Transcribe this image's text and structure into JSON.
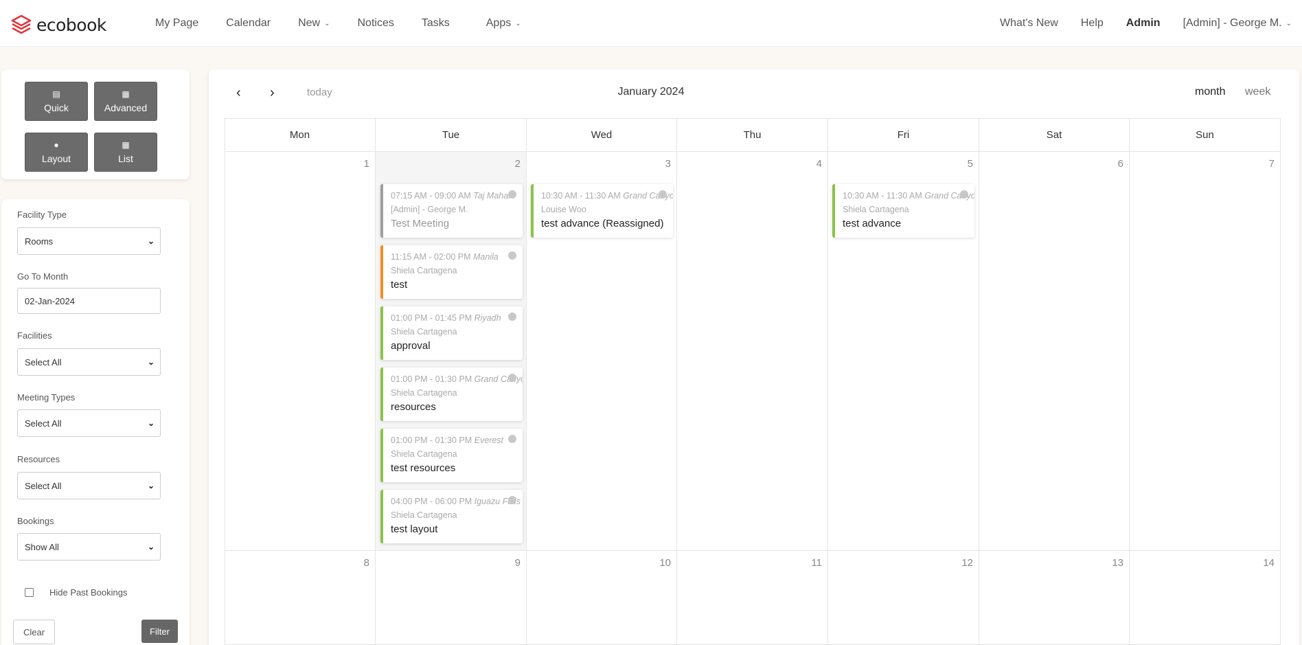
{
  "app": {
    "name": "ecobook"
  },
  "nav": {
    "items": [
      {
        "label": "My Page",
        "dropdown": false
      },
      {
        "label": "Calendar",
        "dropdown": false
      },
      {
        "label": "New",
        "dropdown": true
      },
      {
        "label": "Notices",
        "dropdown": false
      },
      {
        "label": "Tasks",
        "dropdown": false
      },
      {
        "label": "Apps",
        "dropdown": true
      }
    ],
    "right": {
      "whats_new": "What's New",
      "help": "Help",
      "admin": "Admin",
      "user": "[Admin] - George M."
    }
  },
  "view_buttons": [
    {
      "label": "Quick",
      "icon": "list-icon"
    },
    {
      "label": "Advanced",
      "icon": "calendar-icon"
    },
    {
      "label": "Layout",
      "icon": "map-pin-icon"
    },
    {
      "label": "List",
      "icon": "table-icon"
    }
  ],
  "filters": {
    "facility_type": {
      "label": "Facility Type",
      "value": "Rooms"
    },
    "go_to_month": {
      "label": "Go To Month",
      "value": "02-Jan-2024"
    },
    "facilities": {
      "label": "Facilities",
      "value": "Select All"
    },
    "meeting_types": {
      "label": "Meeting Types",
      "value": "Select All"
    },
    "resources": {
      "label": "Resources",
      "value": "Select All"
    },
    "bookings": {
      "label": "Bookings",
      "value": "Show All"
    },
    "hide_past": {
      "label": "Hide Past Bookings",
      "checked": false
    },
    "clear_label": "Clear",
    "filter_label": "Filter"
  },
  "calendar": {
    "title": "January 2024",
    "today_label": "today",
    "view_month": "month",
    "view_week": "week",
    "weekdays": [
      "Mon",
      "Tue",
      "Wed",
      "Thu",
      "Fri",
      "Sat",
      "Sun"
    ],
    "week1": [
      "1",
      "2",
      "3",
      "4",
      "5",
      "6",
      "7"
    ],
    "week2": [
      "8",
      "9",
      "10",
      "11",
      "12",
      "13",
      "14"
    ],
    "events": {
      "tue": [
        {
          "time": "07:15 AM - 09:00 AM",
          "place": "Taj Mahal",
          "who": "[Admin] - George M.",
          "title": "Test Meeting",
          "color": "#9e9e9e"
        },
        {
          "time": "11:15 AM - 02:00 PM",
          "place": "Manila",
          "who": "Shiela Cartagena",
          "title": "test",
          "color": "#f0901e"
        },
        {
          "time": "01:00 PM - 01:45 PM",
          "place": "Riyadh",
          "who": "Shiela Cartagena",
          "title": "approval",
          "color": "#8bc34a"
        },
        {
          "time": "01:00 PM - 01:30 PM",
          "place": "Grand Canyon",
          "who": "Shiela Cartagena",
          "title": "resources",
          "color": "#8bc34a"
        },
        {
          "time": "01:00 PM - 01:30 PM",
          "place": "Everest",
          "who": "Shiela Cartagena",
          "title": "test resources",
          "color": "#8bc34a"
        },
        {
          "time": "04:00 PM - 06:00 PM",
          "place": "Iguazu Falls",
          "who": "Shiela Cartagena",
          "title": "test layout",
          "color": "#8bc34a"
        }
      ],
      "wed": [
        {
          "time": "10:30 AM - 11:30 AM",
          "place": "Grand Canyon",
          "who": "Louise Woo",
          "title": "test advance (Reassigned)",
          "color": "#8bc34a"
        }
      ],
      "fri": [
        {
          "time": "10:30 AM - 11:30 AM",
          "place": "Grand Canyon",
          "who": "Shiela Cartagena",
          "title": "test advance",
          "color": "#8bc34a"
        }
      ]
    }
  }
}
